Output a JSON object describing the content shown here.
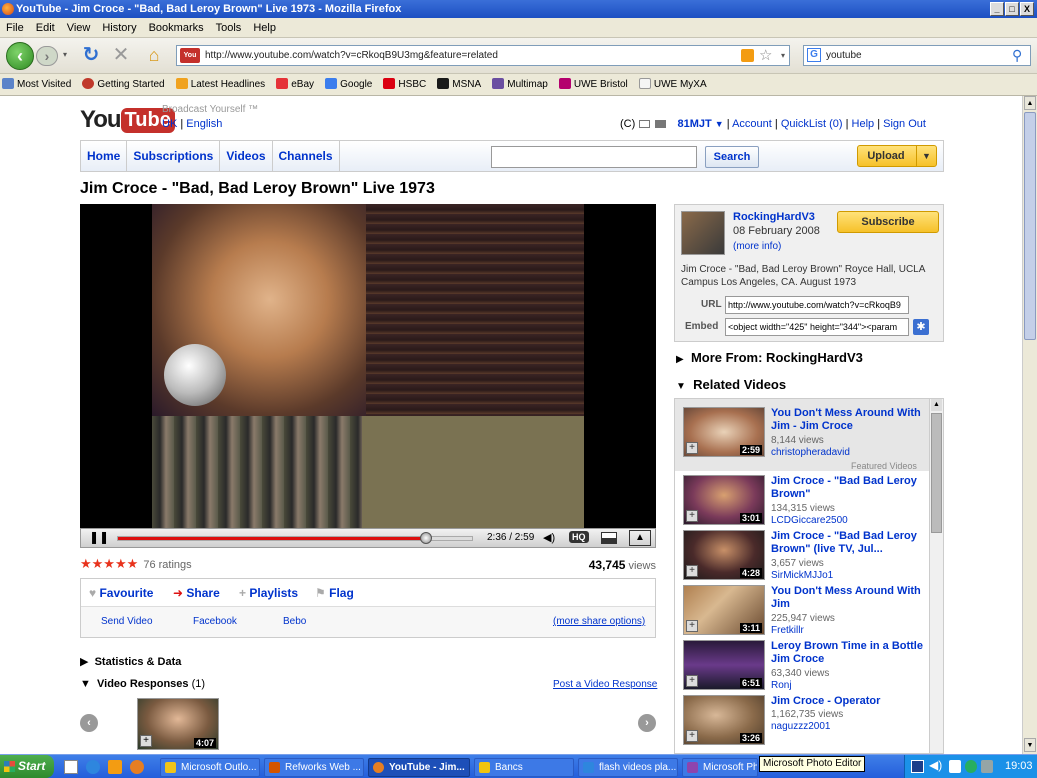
{
  "window": {
    "title": "YouTube - Jim Croce - \"Bad, Bad Leroy Brown\" Live 1973 - Mozilla Firefox",
    "min": "_",
    "max": "□",
    "close": "X"
  },
  "menu": [
    "File",
    "Edit",
    "View",
    "History",
    "Bookmarks",
    "Tools",
    "Help"
  ],
  "nav": {
    "url": "http://www.youtube.com/watch?v=cRkoqB9U3mg&feature=related",
    "search": "youtube"
  },
  "bookmarks": [
    {
      "label": "Most Visited",
      "color": "#5b83c9"
    },
    {
      "label": "Getting Started",
      "color": "#c0392b"
    },
    {
      "label": "Latest Headlines",
      "color": "#f0a21e"
    },
    {
      "label": "eBay",
      "color": "#e53238"
    },
    {
      "label": "Google",
      "color": "#3b7ded"
    },
    {
      "label": "HSBC",
      "color": "#db0011"
    },
    {
      "label": "MSNA",
      "color": "#1a1a1a"
    },
    {
      "label": "Multimap",
      "color": "#6a4ea1"
    },
    {
      "label": "UWE Bristol",
      "color": "#b4006e"
    },
    {
      "label": "UWE MyXA",
      "color": "#f5f5f5"
    }
  ],
  "yt": {
    "logo_you": "You",
    "logo_tube": "Tube",
    "tagline": "Broadcast Yourself ™",
    "region": "UK",
    "language": "English",
    "user": "81MJT",
    "account": "Account",
    "quicklist": "QuickList (0)",
    "help": "Help",
    "signout": "Sign Out",
    "c_label": "(C)",
    "tabs": [
      "Home",
      "Subscriptions",
      "Videos",
      "Channels"
    ],
    "search_btn": "Search",
    "upload": "Upload",
    "video_title": "Jim Croce - \"Bad, Bad Leroy Brown\" Live 1973",
    "player": {
      "time": "2:36 / 2:59",
      "progress": 0.87,
      "hq": "HQ"
    },
    "ratings": "76 ratings",
    "views": "43,745",
    "views_word": "views",
    "actions": [
      "Favourite",
      "Share",
      "Playlists",
      "Flag"
    ],
    "share_links": [
      "Send Video",
      "Facebook",
      "Bebo"
    ],
    "more_share": "(more share options)",
    "stats": "Statistics & Data",
    "responses": "Video Responses",
    "responses_count": "(1)",
    "post_response": "Post a Video Response",
    "response_dur": "4:07",
    "channel": {
      "name": "RockingHardV3",
      "date": "08 February 2008",
      "more": "(more info)",
      "subscribe": "Subscribe",
      "desc": "Jim Croce - \"Bad, Bad Leroy Brown\" Royce Hall, UCLA Campus Los Angeles, CA. August 1973",
      "url_label": "URL",
      "url": "http://www.youtube.com/watch?v=cRkoqB9",
      "embed_label": "Embed",
      "embed": "<object width=\"425\" height=\"344\"><param"
    },
    "more_from": "More From: RockingHardV3",
    "related_heading": "Related Videos",
    "featured": "Featured Videos",
    "related": [
      {
        "title": "You Don't Mess Around With Jim - Jim Croce",
        "views": "8,144 views",
        "user": "christopheradavid",
        "dur": "2:59"
      },
      {
        "title": "Jim Croce - \"Bad Bad Leroy Brown\"",
        "views": "134,315 views",
        "user": "LCDGiccare2500",
        "dur": "3:01"
      },
      {
        "title": "Jim Croce - \"Bad Bad Leroy Brown\" (live TV, Jul...",
        "views": "3,657 views",
        "user": "SirMickMJJo1",
        "dur": "4:28"
      },
      {
        "title": "You Don't Mess Around With Jim",
        "views": "225,947 views",
        "user": "Fretkillr",
        "dur": "3:11"
      },
      {
        "title": "Leroy Brown Time in a Bottle Jim Croce",
        "views": "63,340 views",
        "user": "Ronj",
        "dur": "6:51"
      },
      {
        "title": "Jim Croce - Operator",
        "views": "1,162,735 views",
        "user": "naguzzz2001",
        "dur": "3:26"
      }
    ]
  },
  "taskbar": {
    "start": "Start",
    "clock": "19:03",
    "tooltip": "Microsoft Photo Editor",
    "tasks": [
      {
        "label": "Microsoft Outlo...",
        "color": "#f0c419"
      },
      {
        "label": "Refworks Web ...",
        "color": "#d35400"
      },
      {
        "label": "YouTube - Jim...",
        "color": "#e67e22"
      },
      {
        "label": "Bancs",
        "color": "#f1c40f"
      },
      {
        "label": "flash videos pla...",
        "color": "#2e86de"
      },
      {
        "label": "Microsoft Pho...",
        "color": "#8e44ad"
      }
    ]
  }
}
